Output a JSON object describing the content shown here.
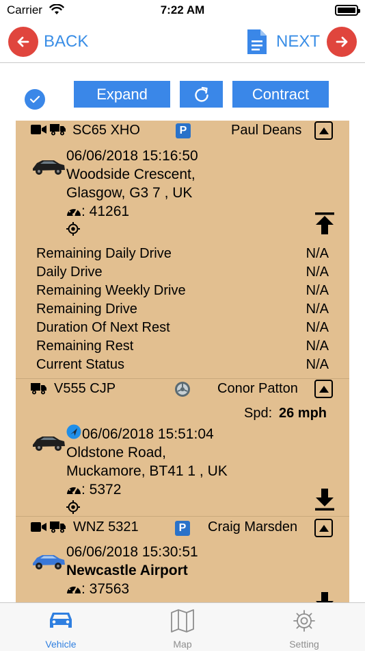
{
  "status_bar": {
    "carrier": "Carrier",
    "time": "7:22 AM"
  },
  "nav": {
    "back_label": "BACK",
    "next_label": "NEXT"
  },
  "controls": {
    "expand_label": "Expand",
    "contract_label": "Contract"
  },
  "vehicles": [
    {
      "reg": "SC65 XHO",
      "driver": "Paul Deans",
      "datetime": "06/06/2018 15:16:50",
      "address_line1": "Woodside Crescent,",
      "address_line2": "Glasgow, G3 7 , UK",
      "odometer": ": 41261",
      "car_color": "#1e1e1e",
      "stats": [
        {
          "label": "Remaining Daily Drive",
          "value": "N/A"
        },
        {
          "label": "Daily Drive",
          "value": "N/A"
        },
        {
          "label": "Remaining Weekly Drive",
          "value": "N/A"
        },
        {
          "label": "Remaining Drive",
          "value": "N/A"
        },
        {
          "label": "Duration Of Next Rest",
          "value": "N/A"
        },
        {
          "label": "Remaining Rest",
          "value": "N/A"
        },
        {
          "label": "Current Status",
          "value": "N/A"
        }
      ]
    },
    {
      "reg": "V555 CJP",
      "driver": "Conor Patton",
      "speed_label": "Spd:",
      "speed_value": "26 mph",
      "datetime": "06/06/2018 15:51:04",
      "address_line1": "Oldstone Road,",
      "address_line2": "Muckamore, BT41 1 , UK",
      "odometer": ": 5372",
      "car_color": "#1e1e1e"
    },
    {
      "reg": "WNZ 5321",
      "driver": "Craig Marsden",
      "datetime": "06/06/2018 15:30:51",
      "address_line1": "Newcastle Airport",
      "odometer": ": 37563",
      "car_color": "#3a78d8"
    }
  ],
  "parking_badge": "P",
  "tabs": [
    {
      "label": "Vehicle",
      "active": true
    },
    {
      "label": "Map",
      "active": false
    },
    {
      "label": "Setting",
      "active": false
    }
  ],
  "colors": {
    "accent": "#3a87e8",
    "nav_red": "#e0453d",
    "list_bg": "#e2bf90"
  }
}
